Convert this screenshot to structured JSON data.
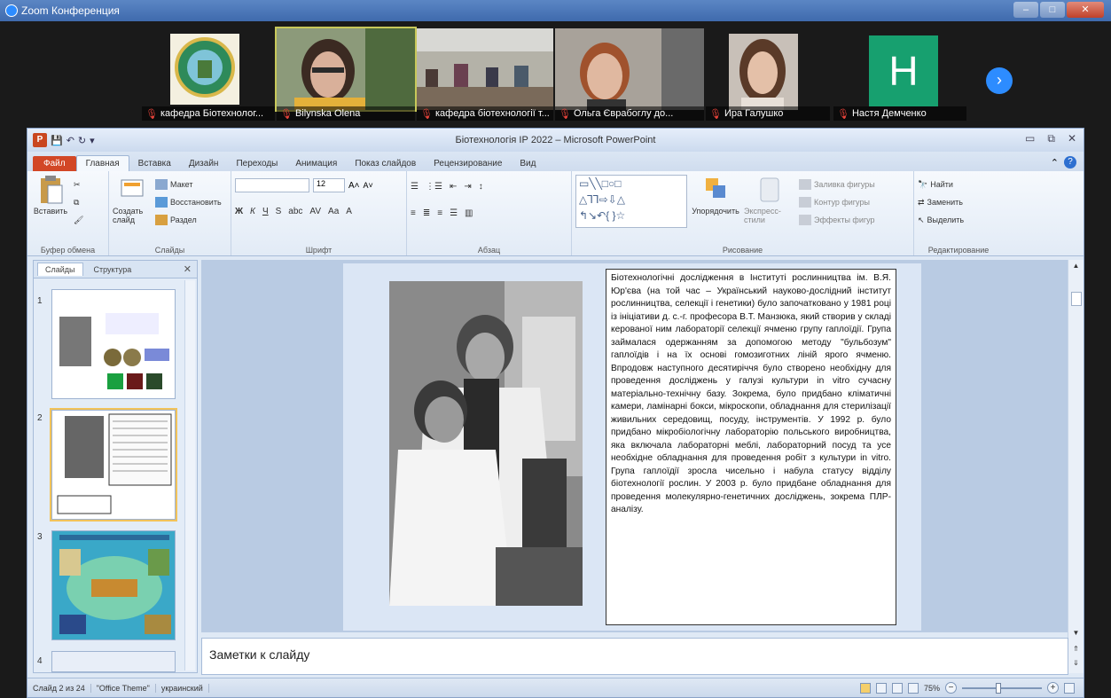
{
  "zoom": {
    "window_title": "Zoom Конференция",
    "participants": [
      {
        "name": "кафедра Біотехнолог..."
      },
      {
        "name": "Bilynska Olena"
      },
      {
        "name": "кафедра біотехнології т..."
      },
      {
        "name": "Ольга Єврабоглу до..."
      },
      {
        "name": "Ира Галушко"
      },
      {
        "name": "Настя Демченко",
        "initial": "H"
      }
    ]
  },
  "ppt": {
    "title": "Біотехнологія ІР 2022 – Microsoft PowerPoint",
    "tabs": [
      "Файл",
      "Главная",
      "Вставка",
      "Дизайн",
      "Переходы",
      "Анимация",
      "Показ слайдов",
      "Рецензирование",
      "Вид"
    ],
    "active_tab": "Главная",
    "ribbon": {
      "clipboard": {
        "label": "Буфер обмена",
        "paste": "Вставить"
      },
      "slides": {
        "label": "Слайды",
        "new_slide": "Создать слайд",
        "layout": "Макет",
        "reset": "Восстановить",
        "section": "Раздел"
      },
      "font": {
        "label": "Шрифт",
        "size": "12"
      },
      "paragraph": {
        "label": "Абзац"
      },
      "drawing": {
        "label": "Рисование",
        "arrange": "Упорядочить",
        "quick_styles": "Экспресс-стили",
        "fill": "Заливка фигуры",
        "outline": "Контур фигуры",
        "effects": "Эффекты фигур"
      },
      "editing": {
        "label": "Редактирование",
        "find": "Найти",
        "replace": "Заменить",
        "select": "Выделить"
      }
    },
    "panel": {
      "tab_slides": "Слайды",
      "tab_outline": "Структура",
      "thumb_numbers": [
        "1",
        "2",
        "3",
        "4"
      ]
    },
    "slide_text": "Біотехнологічні дослідження в Інституті рослинництва ім. В.Я. Юр'єва (на той час – Український науково-дослідний інститут рослинництва, селекції і генетики) було започатковано у 1981 році із ініціативи д. с.-г. професора В.Т. Манзюка, який створив у складі керованої ним лабораторії селекції ячменю групу гаплоїдії. Група займалася одержанням за допомогою методу \"бульбозум\" гаплоїдів і на їх основі гомозиготних ліній ярого ячменю. Впродовж наступного десятиріччя було створено необхідну для проведення досліджень у галузі культури in vitro сучасну матеріально-технічну базу. Зокрема, було придбано кліматичні камери, ламінарні бокси, мікроскопи, обладнання для стерилізації живильних середовищ, посуду, інструментів. У 1992 р. було придбано мікробіологічну лабораторію польського виробництва, яка включала лабораторні меблі, лабораторний посуд та усе необхідне обладнання для проведення робіт з культури in vitro. Група гаплоїдії зросла чисельно і набула статусу відділу біотехнології рослин. У 2003 р. було придбане обладнання для проведення молекулярно-генетичних досліджень, зокрема ПЛР-аналізу.",
    "notes_placeholder": "Заметки к слайду",
    "status": {
      "slide": "Слайд 2 из 24",
      "theme": "\"Office Theme\"",
      "language": "украинский",
      "zoom": "75%"
    }
  }
}
